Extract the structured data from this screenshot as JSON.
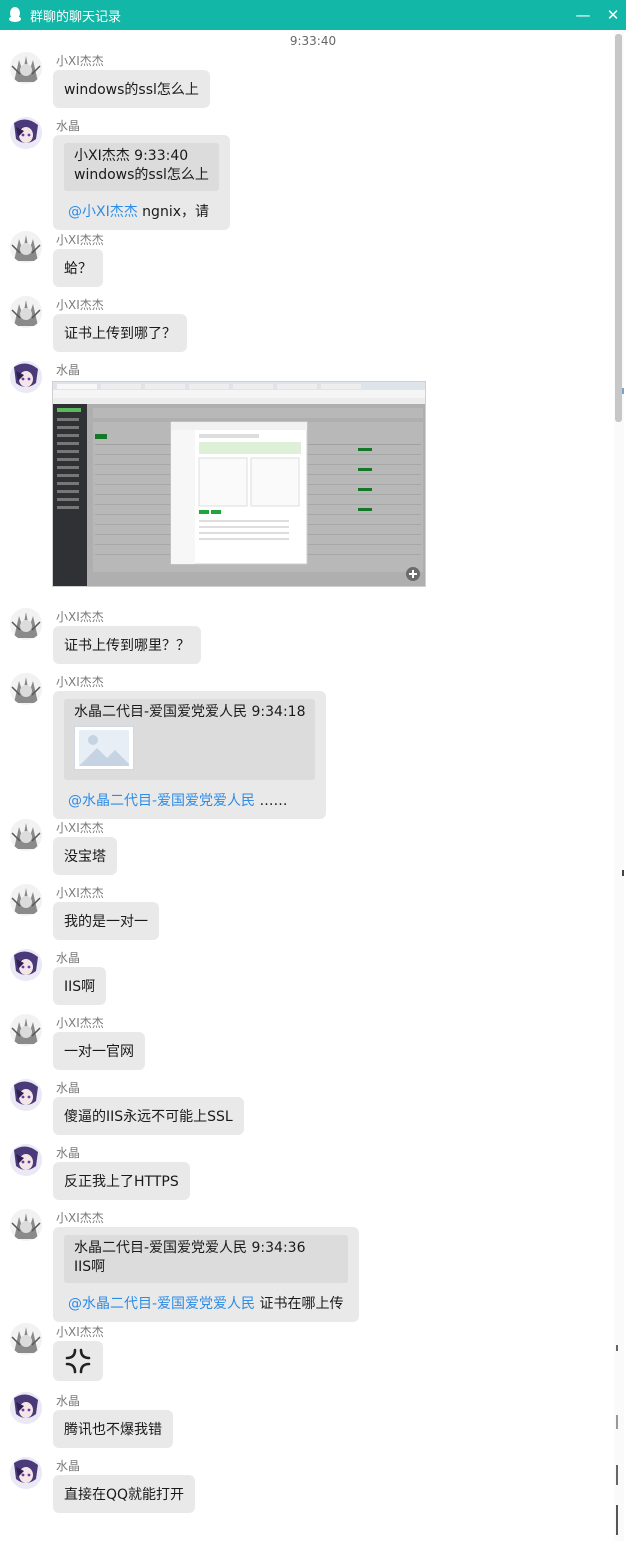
{
  "window": {
    "title": "群聊的聊天记录",
    "minimize": "—",
    "close": "✕"
  },
  "timestamp": "9:33:40",
  "messages": [
    {
      "sender": "小XI杰杰",
      "text": "windows的ssl怎么上"
    },
    {
      "sender": "水晶",
      "quote_header": "小XI杰杰   9:33:40",
      "quote_text": "windows的ssl怎么上",
      "mention": "@小XI杰杰",
      "text": " ngnix，请"
    },
    {
      "sender": "小XI杰杰",
      "text": "蛤？"
    },
    {
      "sender": "小XI杰杰",
      "text": "证书上传到哪了？"
    },
    {
      "sender": "水晶",
      "image": "screenshot-of-ssl-panel"
    },
    {
      "sender": "小XI杰杰",
      "text": "证书上传到哪里？？"
    },
    {
      "sender": "小XI杰杰",
      "quote_header": "水晶二代目-爱国爱党爱人民   9:34:18",
      "mention": "@水晶二代目-爱国爱党爱人民",
      "text": " ……"
    },
    {
      "sender": "小XI杰杰",
      "text": "没宝塔"
    },
    {
      "sender": "小XI杰杰",
      "text": "我的是一对一"
    },
    {
      "sender": "水晶",
      "text": "IIS啊"
    },
    {
      "sender": "小XI杰杰",
      "text": "一对一官网"
    },
    {
      "sender": "水晶",
      "text": "傻逼的IIS永远不可能上SSL"
    },
    {
      "sender": "水晶",
      "text": "反正我上了HTTPS"
    },
    {
      "sender": "小XI杰杰",
      "quote_header": "水晶二代目-爱国爱党爱人民   9:34:36",
      "quote_text": "IIS啊",
      "mention": "@水晶二代目-爱国爱党爱人民",
      "text": " 证书在哪上传"
    },
    {
      "sender": "小XI杰杰",
      "emoji": "anger-emoji"
    },
    {
      "sender": "水晶",
      "text": "腾讯也不爆我错"
    },
    {
      "sender": "水晶",
      "text": "直接在QQ就能打开"
    }
  ],
  "colors": {
    "titlebar": "#12b7a7",
    "bubble": "#e9e9e9",
    "quote": "#dcdcdc",
    "mention": "#2d8ce6"
  }
}
